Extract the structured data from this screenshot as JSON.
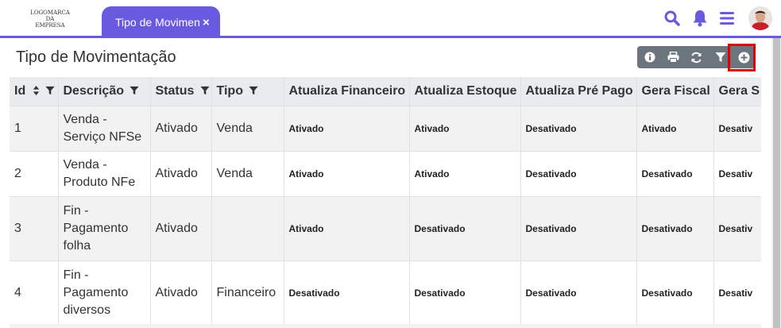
{
  "logo": {
    "line1": "LOGOMARCA",
    "line2": "DA",
    "line3": "EMPRESA"
  },
  "tab": {
    "label": "Tipo de Movimentação",
    "close": "×"
  },
  "header_icons": [
    "search-icon",
    "bell-icon",
    "menu-icon",
    "avatar"
  ],
  "colors": {
    "accent": "#6a5ae0",
    "toolbar": "#6c757d",
    "highlight": "#e00000",
    "header_bg": "#e9ecef"
  },
  "page": {
    "title": "Tipo de Movimentação"
  },
  "toolbar": [
    "info-icon",
    "print-icon",
    "refresh-icon",
    "filter-icon",
    "add-icon"
  ],
  "table": {
    "columns": [
      "Id",
      "Descrição",
      "Status",
      "Tipo",
      "Atualiza Financeiro",
      "Atualiza Estoque",
      "Atualiza Pré Pago",
      "Gera Fiscal",
      "Gera S"
    ],
    "rows": [
      [
        "1",
        "Venda - Serviço NFSe",
        "Ativado",
        "Venda",
        "Ativado",
        "Ativado",
        "Desativado",
        "Ativado",
        "Desativ"
      ],
      [
        "2",
        "Venda - Produto NFe",
        "Ativado",
        "Venda",
        "Ativado",
        "Ativado",
        "Desativado",
        "Desativado",
        "Desativ"
      ],
      [
        "3",
        "Fin - Pagamento folha",
        "Ativado",
        "",
        "Ativado",
        "Desativado",
        "Desativado",
        "Desativado",
        "Desativ"
      ],
      [
        "4",
        "Fin - Pagamento diversos",
        "Ativado",
        "Financeiro",
        "Desativado",
        "Desativado",
        "Desativado",
        "Desativado",
        "Desativ"
      ]
    ]
  }
}
